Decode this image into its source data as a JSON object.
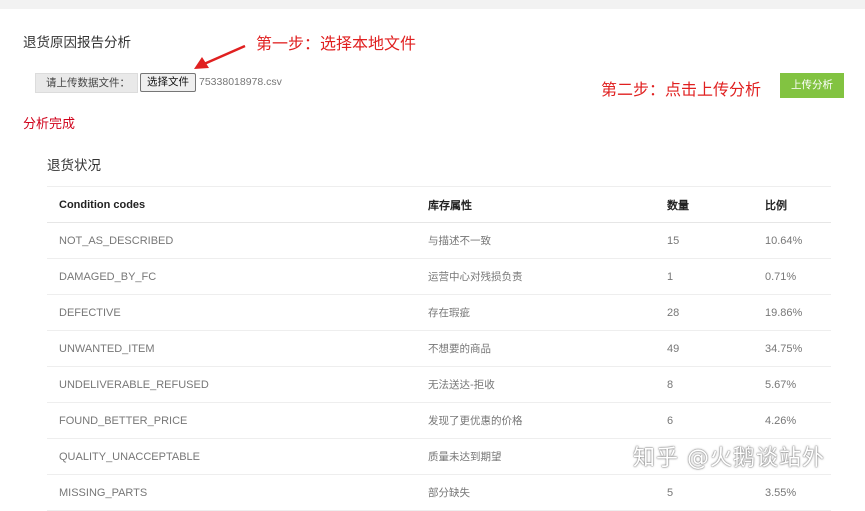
{
  "page": {
    "title": "退货原因报告分析",
    "step1": "第一步：选择本地文件",
    "step2": "第二步：点击上传分析",
    "watermark": "知乎 @火鹅谈站外"
  },
  "upload": {
    "label": "请上传数据文件：",
    "choose_button": "选择文件",
    "file_name": "75338018978.csv",
    "submit_button": "上传分析"
  },
  "status": "分析完成",
  "section_title": "退货状况",
  "table": {
    "headers": [
      "Condition codes",
      "库存属性",
      "数量",
      "比例"
    ],
    "rows": [
      [
        "NOT_AS_DESCRIBED",
        "与描述不一致",
        "15",
        "10.64%"
      ],
      [
        "DAMAGED_BY_FC",
        "运营中心对残损负责",
        "1",
        "0.71%"
      ],
      [
        "DEFECTIVE",
        "存在瑕疵",
        "28",
        "19.86%"
      ],
      [
        "UNWANTED_ITEM",
        "不想要的商品",
        "49",
        "34.75%"
      ],
      [
        "UNDELIVERABLE_REFUSED",
        "无法送达-拒收",
        "8",
        "5.67%"
      ],
      [
        "FOUND_BETTER_PRICE",
        "发现了更优惠的价格",
        "6",
        "4.26%"
      ],
      [
        "QUALITY_UNACCEPTABLE",
        "质量未达到期望",
        "",
        ""
      ],
      [
        "MISSING_PARTS",
        "部分缺失",
        "5",
        "3.55%"
      ]
    ]
  },
  "colors": {
    "accent_green": "#82c341",
    "annotation_red": "#e02020",
    "status_red": "#d0021b"
  }
}
